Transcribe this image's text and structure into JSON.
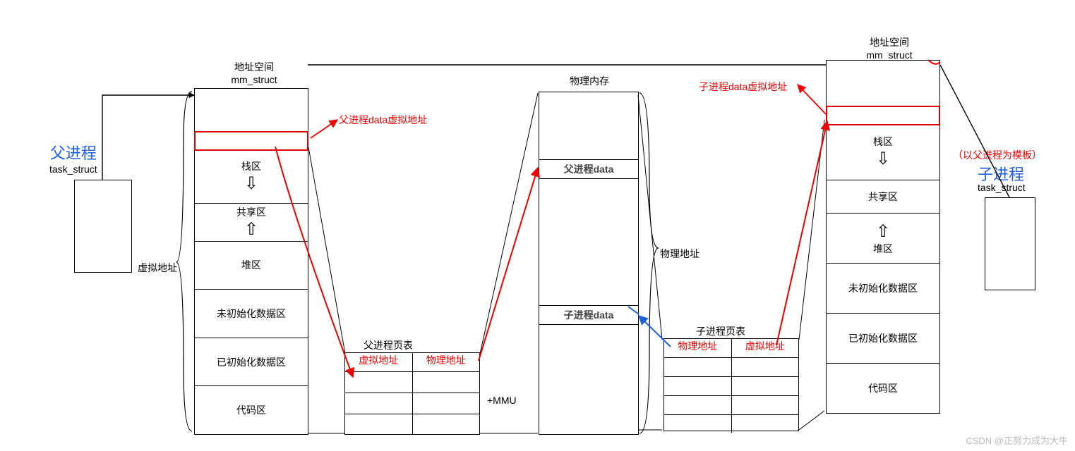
{
  "parent": {
    "title": "父进程",
    "task_struct": "task_struct",
    "virt_label": "虚拟地址",
    "mm_title1": "地址空间",
    "mm_title2": "mm_struct",
    "regions": [
      "栈区",
      "共享区",
      "堆区",
      "未初始化数据区",
      "已初始化数据区",
      "代码区"
    ],
    "data_note": "父进程data虚拟地址",
    "pt_title": "父进程页表",
    "pt_col1": "虚拟地址",
    "pt_col2": "物理地址"
  },
  "child": {
    "title": "子进程",
    "task_struct": "task_struct",
    "template_note": "（以父进程为模板）",
    "mm_title1": "地址空间",
    "mm_title2": "mm_struct",
    "regions": [
      "栈区",
      "共享区",
      "堆区",
      "未初始化数据区",
      "已初始化数据区",
      "代码区"
    ],
    "data_note": "子进程data虚拟地址",
    "pt_title": "子进程页表",
    "pt_col1": "物理地址",
    "pt_col2": "虚拟地址"
  },
  "phys": {
    "title": "物理内存",
    "parent_data": "父进程data",
    "child_data": "子进程data",
    "addr_label": "物理地址",
    "mmu": "+MMU"
  },
  "watermark": "CSDN @正努力成为大牛"
}
